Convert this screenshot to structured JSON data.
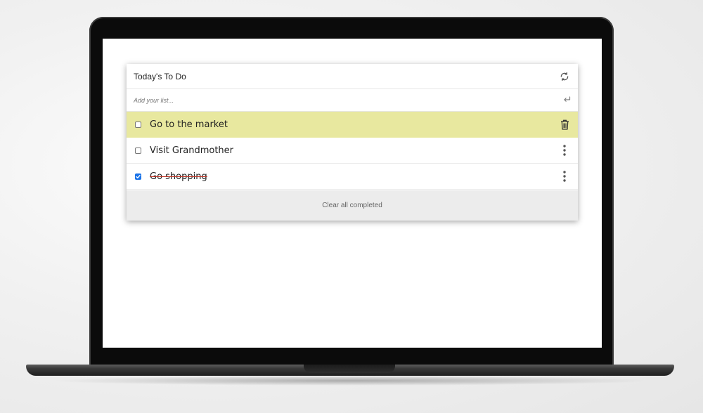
{
  "app": {
    "title": "Today's To Do",
    "refresh_icon": "refresh-icon"
  },
  "input": {
    "placeholder": "Add your list...",
    "value": "",
    "enter_icon": "enter-icon"
  },
  "todos": [
    {
      "text": "Go to the market",
      "checked": false,
      "highlighted": true,
      "action_icon": "trash-icon"
    },
    {
      "text": "Visit Grandmother",
      "checked": false,
      "highlighted": false,
      "action_icon": "more-vertical-icon"
    },
    {
      "text": "Go shopping",
      "checked": true,
      "highlighted": false,
      "action_icon": "more-vertical-icon"
    }
  ],
  "footer": {
    "clear_label": "Clear all completed"
  },
  "colors": {
    "highlight": "#e8e89f",
    "footer_bg": "#ececec",
    "checkbox_checked": "#1a73e8",
    "strike": "#c0392b"
  }
}
